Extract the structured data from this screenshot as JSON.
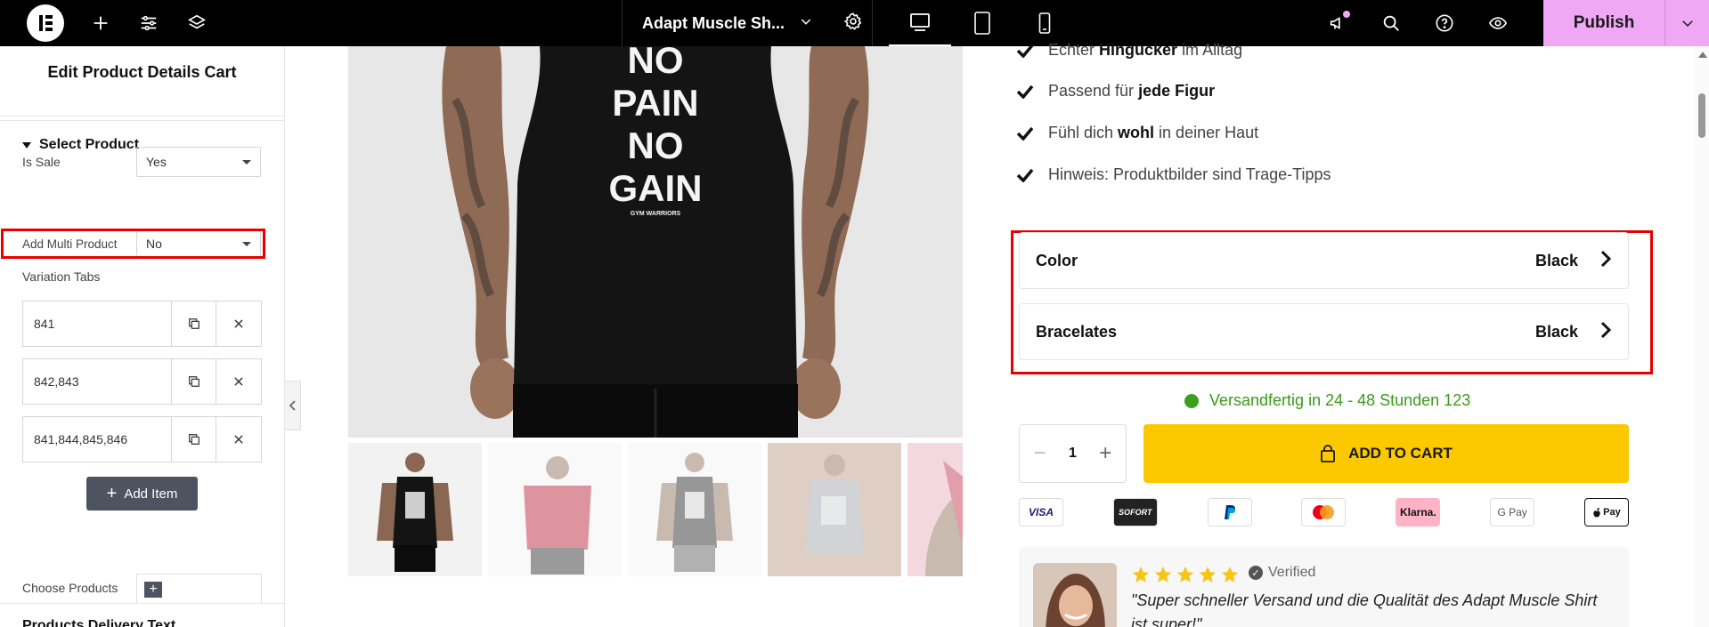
{
  "topbar": {
    "document_title": "Adapt Muscle Sh...",
    "publish_label": "Publish"
  },
  "panel": {
    "title": "Edit Product Details Cart",
    "section_select_product": "Select Product",
    "is_sale": {
      "label": "Is Sale",
      "value": "Yes"
    },
    "add_multi_product": {
      "label": "Add Multi Product",
      "value": "No"
    },
    "variation_tabs_label": "Variation Tabs",
    "variation_items": [
      "841",
      "842,843",
      "841,844,845,846"
    ],
    "add_item_label": "Add Item",
    "choose_products_label": "Choose Products",
    "next_section": "Products Delivery Text"
  },
  "product": {
    "features": [
      {
        "pre": "Echter",
        "bold": "Hingucker",
        "post": "im Alltag"
      },
      {
        "pre": "Passend für",
        "bold": "jede Figur",
        "post": ""
      },
      {
        "pre": "Fühl dich",
        "bold": "wohl",
        "post": "in deiner Haut"
      },
      {
        "pre": "Hinweis: Produktbilder sind Trage-Tipps",
        "bold": "",
        "post": ""
      }
    ],
    "variations": [
      {
        "name": "Color",
        "value": "Black"
      },
      {
        "name": "Bracelates",
        "value": "Black"
      }
    ],
    "stock_text": "Versandfertig in 24 - 48 Stunden 123",
    "quantity": "1",
    "add_to_cart": "ADD TO CART",
    "payments": [
      "VISA",
      "SOFORT",
      "PayPal",
      "Mastercard",
      "Klarna.",
      "G Pay",
      "Apple Pay"
    ],
    "shirt_text": [
      "NO",
      "PAIN",
      "NO",
      "GAIN"
    ],
    "shirt_brand": "GYM WARRIORS",
    "review": {
      "verified": "Verified",
      "rating": 5,
      "quote": "\"Super schneller Versand und die Qualität des Adapt Muscle Shirt ist super!\""
    }
  },
  "colors": {
    "topbar": "#000000",
    "publish": "#f0a8f5",
    "add_to_cart": "#fcc800",
    "highlight": "#e60000",
    "stock": "#3a9a1a",
    "star": "#f5c518"
  }
}
